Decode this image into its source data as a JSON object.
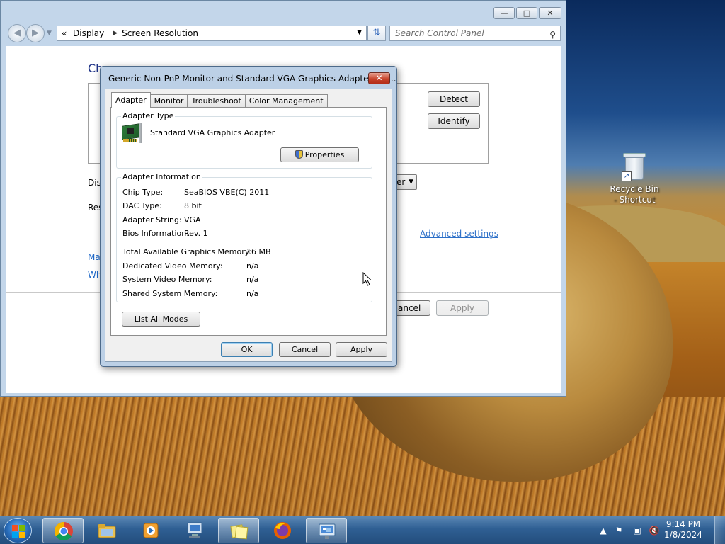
{
  "control_panel": {
    "breadcrumb": [
      "Display",
      "Screen Resolution"
    ],
    "search_placeholder": "Search Control Panel",
    "heading_fragment": "Ch",
    "buttons": {
      "detect": "Detect",
      "identify": "Identify",
      "cancel_fragment": "ancel",
      "apply": "Apply"
    },
    "labels": {
      "display_fragment": "Disp",
      "resolution_fragment": "Res"
    },
    "orientation_fragment": "er",
    "links": {
      "advanced_settings": "Advanced settings",
      "make_fragment": "Ma",
      "what_fragment": "Wh"
    }
  },
  "dialog": {
    "title": "Generic Non-PnP Monitor and Standard VGA Graphics Adapter Pro...",
    "tabs": [
      "Adapter",
      "Monitor",
      "Troubleshoot",
      "Color Management"
    ],
    "active_tab": "Adapter",
    "adapter_type": {
      "legend": "Adapter Type",
      "name": "Standard VGA Graphics Adapter",
      "properties_button": "Properties"
    },
    "adapter_info": {
      "legend": "Adapter Information",
      "rows": [
        {
          "label": "Chip Type:",
          "value": "SeaBIOS VBE(C) 2011"
        },
        {
          "label": "DAC Type:",
          "value": "8 bit"
        },
        {
          "label": "Adapter String:",
          "value": "VGA"
        },
        {
          "label": "Bios Information:",
          "value": "Rev. 1"
        }
      ],
      "memory_rows": [
        {
          "label": "Total Available Graphics Memory:",
          "value": "16 MB"
        },
        {
          "label": "Dedicated Video Memory:",
          "value": "n/a"
        },
        {
          "label": "System Video Memory:",
          "value": "n/a"
        },
        {
          "label": "Shared System Memory:",
          "value": "n/a"
        }
      ]
    },
    "list_modes_button": "List All Modes",
    "ok": "OK",
    "cancel": "Cancel",
    "apply": "Apply"
  },
  "desktop": {
    "recycle_bin": "Recycle Bin - Shortcut"
  },
  "taskbar": {
    "items": [
      "chrome-icon",
      "file-explorer-icon",
      "media-player-icon",
      "network-computer-icon",
      "sticky-notes-icon",
      "firefox-icon",
      "display-settings-icon"
    ],
    "time": "9:14 PM",
    "date": "1/8/2024"
  }
}
